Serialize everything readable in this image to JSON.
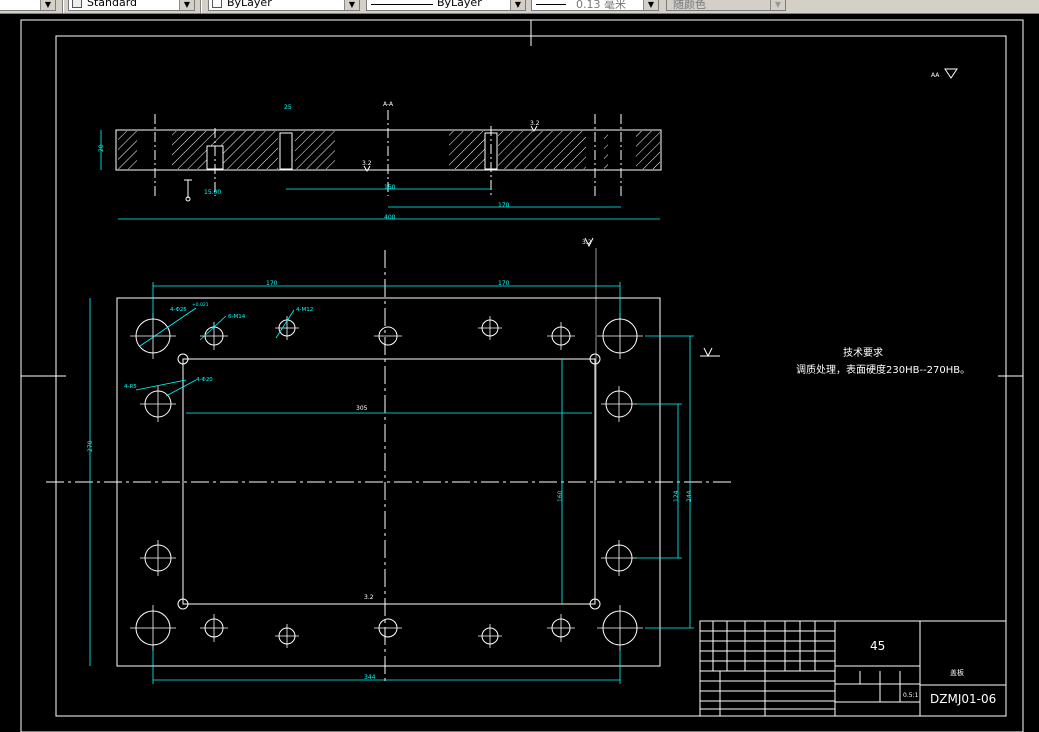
{
  "toolbar": {
    "dimstyle": "Standard",
    "color": "ByLayer",
    "linetype": "ByLayer",
    "lineweight": "0.13 毫米",
    "plotstyle": "随颜色"
  },
  "drawing": {
    "section_label": "A-A",
    "roughness_top_right": "AA",
    "roughness_values": {
      "r1": "3.2",
      "r2": "3.2",
      "r3": "3.2",
      "r4": "3.2"
    },
    "section_dims": {
      "overall": "400",
      "inner": "150",
      "right": "170",
      "depth": "25",
      "thick": "20",
      "hole": "15.00"
    },
    "plan_dims": {
      "left_top": "170",
      "right_top": "170",
      "height": "270",
      "bottom": "344",
      "v1": "160",
      "v2": "124",
      "v3": "244",
      "pocket": "305"
    },
    "hole_callouts": {
      "h1": "4-Φ25",
      "h1_tol": "+0.021",
      "h2": "6-M14",
      "h3": "4-M12",
      "h4": "4-R5",
      "h5": "4-Φ20"
    },
    "tech_title": "技术要求",
    "tech_text": "调质处理，表面硬度230HB--270HB。",
    "title_block": {
      "material": "45",
      "drawing_no": "DZMJ01-06",
      "scale": "0.5:1",
      "part_name": "盖板"
    }
  }
}
